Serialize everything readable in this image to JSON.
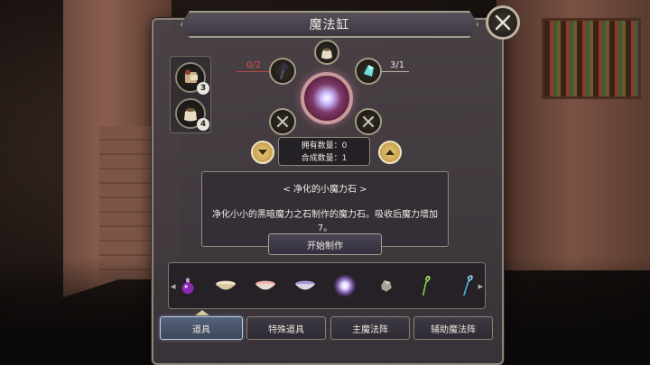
{
  "title": "魔法缸",
  "materials": [
    {
      "icon": "scroll-pouch-icon",
      "count": "3"
    },
    {
      "icon": "sack-icon",
      "count": "4"
    }
  ],
  "slots": {
    "left_count": "0/2",
    "right_count": "3/1",
    "top_icon": "sack-icon",
    "left_icon": "dark-staff-icon",
    "right_icon": "crystal-shard-icon",
    "result_icon": "glowing-orb-icon"
  },
  "quantity": {
    "owned": "拥有数量：0",
    "craft": "合成数量：1"
  },
  "description": {
    "name": "< 净化的小魔力石 >",
    "text": "净化小小的黑暗魔力之石制作的魔力石。吸收后魔力增加7。"
  },
  "start_button": "开始制作",
  "items": [
    {
      "icon": "purple-potion-icon"
    },
    {
      "icon": "cream-bowl-icon"
    },
    {
      "icon": "pink-bowl-icon"
    },
    {
      "icon": "lavender-bowl-icon"
    },
    {
      "icon": "glowing-orb-icon"
    },
    {
      "icon": "stone-icon"
    },
    {
      "icon": "green-staff-icon"
    },
    {
      "icon": "blue-staff-icon"
    }
  ],
  "tabs": [
    "道具",
    "特殊道具",
    "主魔法阵",
    "辅助魔法阵"
  ],
  "active_tab": "道具"
}
